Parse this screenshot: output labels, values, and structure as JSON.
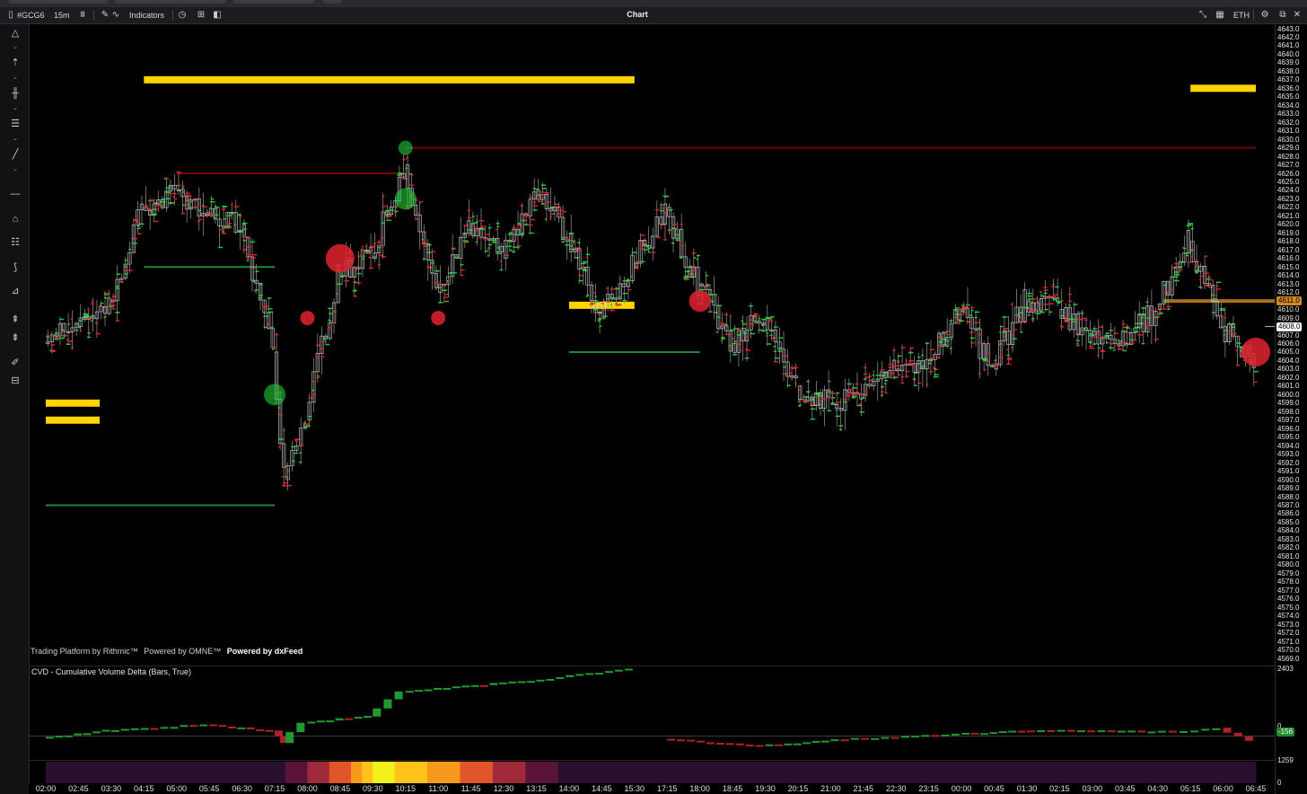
{
  "toolbar": {
    "symbol": "#GCG6",
    "interval": "15m",
    "indicators_label": "Indicators",
    "title": "Chart",
    "session": "ETH"
  },
  "icons": [
    "chart-type-icon",
    "pencil-icon",
    "indicators-icon",
    "clock-icon",
    "template-icon",
    "layout-icon",
    "collapse-icon",
    "calendar-icon",
    "settings-icon",
    "close-icon"
  ],
  "branding": {
    "rithmic": "Trading Platform by Rithmic™",
    "omne": "Powered by OMNE™",
    "dxfeed": "Powered by dxFeed"
  },
  "cvd": {
    "label": "CVD - Cumulative Volume Delta (Bars, True)",
    "axis_top": "2403",
    "axis_zero": "0",
    "current_value": "-156"
  },
  "volume_panel": {
    "axis_top": "1259",
    "axis_zero": "0"
  },
  "price_axis": {
    "high": "4643.0",
    "low": "4569.0",
    "step": 1,
    "current_price": "4608.0",
    "marker_price": "4611.0"
  },
  "colors": {
    "background": "#000000",
    "up": "#1fcf3a",
    "down": "#e0222e",
    "level_yellow": "#ffd400",
    "level_red": "#7a0000",
    "level_green": "#1a8a2a",
    "marker_orange": "#d28a1e"
  },
  "chart_data": {
    "type": "candlestick",
    "xlabel": "",
    "ylabel": "",
    "x_ticks": [
      "02:00",
      "02:45",
      "03:30",
      "04:15",
      "05:00",
      "05:45",
      "06:30",
      "07:15",
      "08:00",
      "08:45",
      "09:30",
      "10:15",
      "11:00",
      "11:45",
      "12:30",
      "13:15",
      "14:00",
      "14:45",
      "15:30",
      "17:15",
      "18:00",
      "18:45",
      "19:30",
      "20:15",
      "21:00",
      "21:45",
      "22:30",
      "23:15",
      "00:00",
      "00:45",
      "01:30",
      "02:15",
      "03:00",
      "03:45",
      "04:30",
      "05:15",
      "06:00",
      "06:45"
    ],
    "ylim": [
      4569,
      4643
    ],
    "close_path": [
      [
        "02:00",
        4606
      ],
      [
        "02:45",
        4608
      ],
      [
        "03:30",
        4611
      ],
      [
        "04:15",
        4622
      ],
      [
        "05:00",
        4624
      ],
      [
        "05:45",
        4621
      ],
      [
        "06:30",
        4620
      ],
      [
        "07:15",
        4605
      ],
      [
        "07:30",
        4590
      ],
      [
        "08:00",
        4597
      ],
      [
        "08:45",
        4614
      ],
      [
        "09:30",
        4616
      ],
      [
        "10:15",
        4627
      ],
      [
        "11:00",
        4612
      ],
      [
        "11:45",
        4620
      ],
      [
        "12:30",
        4616
      ],
      [
        "13:15",
        4624
      ],
      [
        "14:00",
        4619
      ],
      [
        "14:45",
        4609
      ],
      [
        "15:30",
        4615
      ],
      [
        "17:15",
        4622
      ],
      [
        "18:00",
        4613
      ],
      [
        "18:45",
        4606
      ],
      [
        "19:30",
        4609
      ],
      [
        "20:15",
        4601
      ],
      [
        "21:00",
        4599
      ],
      [
        "21:45",
        4600
      ],
      [
        "22:30",
        4603
      ],
      [
        "23:15",
        4604
      ],
      [
        "00:00",
        4610
      ],
      [
        "00:45",
        4603
      ],
      [
        "01:30",
        4611
      ],
      [
        "02:15",
        4610
      ],
      [
        "03:00",
        4607
      ],
      [
        "03:45",
        4606
      ],
      [
        "04:30",
        4610
      ],
      [
        "05:15",
        4618
      ],
      [
        "06:00",
        4608
      ],
      [
        "06:45",
        4604
      ]
    ],
    "levels": [
      {
        "kind": "yellow",
        "price": 4637,
        "from": "04:15",
        "to": "15:30"
      },
      {
        "kind": "yellow",
        "price": 4636,
        "from": "05:15",
        "to": "06:45"
      },
      {
        "kind": "yellow",
        "price": 4599,
        "from": "02:00",
        "to": "02:45"
      },
      {
        "kind": "yellow",
        "price": 4597,
        "from": "02:00",
        "to": "02:45"
      },
      {
        "kind": "yellow",
        "price": 4610.5,
        "from": "14:00",
        "to": "15:30"
      },
      {
        "kind": "red",
        "price": 4629,
        "from": "10:15",
        "to": "06:45"
      },
      {
        "kind": "red",
        "price": 4626,
        "from": "05:00",
        "to": "10:15"
      },
      {
        "kind": "green",
        "price": 4615,
        "from": "04:15",
        "to": "07:15"
      },
      {
        "kind": "green",
        "price": 4587,
        "from": "02:00",
        "to": "07:15"
      },
      {
        "kind": "green",
        "price": 4605,
        "from": "14:00",
        "to": "18:00"
      }
    ],
    "bubbles": [
      {
        "t": "08:45",
        "price": 4616,
        "side": "sell",
        "size": 3
      },
      {
        "t": "10:15",
        "price": 4629,
        "side": "buy",
        "size": 1
      },
      {
        "t": "10:15",
        "price": 4623,
        "side": "buy",
        "size": 2
      },
      {
        "t": "07:15",
        "price": 4600,
        "side": "buy",
        "size": 2
      },
      {
        "t": "08:00",
        "price": 4609,
        "side": "sell",
        "size": 1
      },
      {
        "t": "11:00",
        "price": 4609,
        "side": "sell",
        "size": 1
      },
      {
        "t": "18:00",
        "price": 4611,
        "side": "sell",
        "size": 2
      },
      {
        "t": "06:45",
        "price": 4605,
        "side": "sell",
        "size": 3
      }
    ],
    "cvd_path": [
      [
        "02:00",
        -60
      ],
      [
        "03:30",
        200
      ],
      [
        "05:45",
        420
      ],
      [
        "07:15",
        200
      ],
      [
        "07:30",
        -250
      ],
      [
        "08:00",
        500
      ],
      [
        "09:30",
        700
      ],
      [
        "10:15",
        1600
      ],
      [
        "11:45",
        1800
      ],
      [
        "13:15",
        2000
      ],
      [
        "15:30",
        2403
      ],
      [
        "17:15",
        -100
      ],
      [
        "19:30",
        -350
      ],
      [
        "21:00",
        -150
      ],
      [
        "00:00",
        80
      ],
      [
        "01:30",
        200
      ],
      [
        "04:30",
        180
      ],
      [
        "05:15",
        150
      ],
      [
        "06:00",
        300
      ],
      [
        "06:45",
        -156
      ]
    ],
    "volume_heat": [
      [
        "02:00",
        0.1
      ],
      [
        "07:15",
        0.15
      ],
      [
        "08:00",
        0.4
      ],
      [
        "08:45",
        0.65
      ],
      [
        "09:30",
        1.0
      ],
      [
        "10:15",
        0.9
      ],
      [
        "11:00",
        0.75
      ],
      [
        "11:45",
        0.55
      ],
      [
        "12:30",
        0.4
      ],
      [
        "13:15",
        0.25
      ],
      [
        "14:00",
        0.15
      ],
      [
        "17:15",
        0.1
      ],
      [
        "00:00",
        0.12
      ],
      [
        "03:00",
        0.08
      ],
      [
        "06:45",
        0.1
      ]
    ]
  }
}
